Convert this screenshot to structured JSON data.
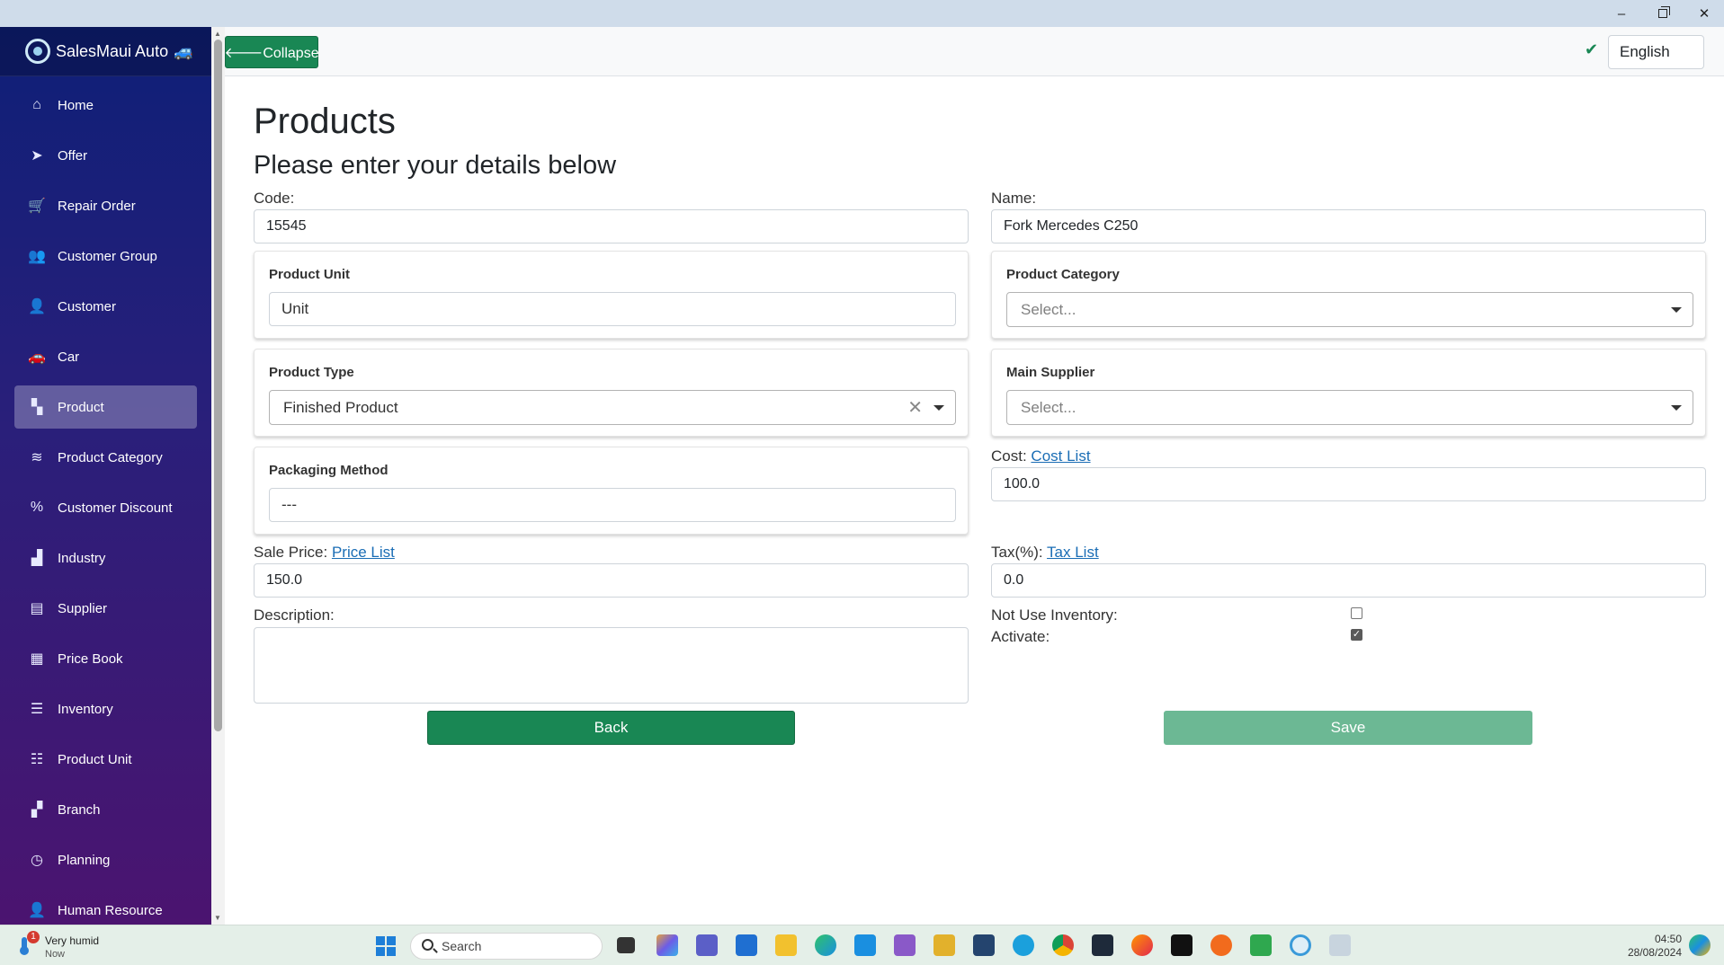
{
  "window": {
    "minimize_glyph": "–",
    "close_glyph": "✕"
  },
  "sidebar": {
    "brand": "SalesMaui Auto",
    "items": [
      {
        "label": "Home",
        "icon": "home-icon",
        "glyph": "⌂"
      },
      {
        "label": "Offer",
        "icon": "paper-plane-icon",
        "glyph": "➤"
      },
      {
        "label": "Repair Order",
        "icon": "cart-icon",
        "glyph": "🛒"
      },
      {
        "label": "Customer Group",
        "icon": "users-icon",
        "glyph": "👥"
      },
      {
        "label": "Customer",
        "icon": "user-icon",
        "glyph": "👤"
      },
      {
        "label": "Car",
        "icon": "car-icon",
        "glyph": "🚗"
      },
      {
        "label": "Product",
        "icon": "product-icon",
        "glyph": "▚",
        "active": true
      },
      {
        "label": "Product Category",
        "icon": "layers-icon",
        "glyph": "≋"
      },
      {
        "label": "Customer Discount",
        "icon": "percent-icon",
        "glyph": "%"
      },
      {
        "label": "Industry",
        "icon": "chart-icon",
        "glyph": "▟"
      },
      {
        "label": "Supplier",
        "icon": "warehouse-icon",
        "glyph": "▤"
      },
      {
        "label": "Price Book",
        "icon": "table-icon",
        "glyph": "▦"
      },
      {
        "label": "Inventory",
        "icon": "list-check-icon",
        "glyph": "☰"
      },
      {
        "label": "Product Unit",
        "icon": "list-icon",
        "glyph": "☷"
      },
      {
        "label": "Branch",
        "icon": "grid-icon",
        "glyph": "▞"
      },
      {
        "label": "Planning",
        "icon": "clock-icon",
        "glyph": "◷"
      },
      {
        "label": "Human Resource",
        "icon": "person-icon",
        "glyph": "👤"
      }
    ]
  },
  "topbar": {
    "collapse_label": "🡐Collapse",
    "language": "English",
    "status_glyph": "✔"
  },
  "page": {
    "title": "Products",
    "subtitle": "Please enter your details below"
  },
  "form": {
    "code_label": "Code:",
    "code_value": "15545",
    "name_label": "Name:",
    "name_value": "Fork Mercedes C250",
    "product_unit_label": "Product Unit",
    "product_unit_value": "Unit",
    "product_category_label": "Product Category",
    "product_category_placeholder": "Select...",
    "product_type_label": "Product Type",
    "product_type_value": "Finished Product",
    "main_supplier_label": "Main Supplier",
    "main_supplier_placeholder": "Select...",
    "packaging_method_label": "Packaging Method",
    "packaging_method_value": "---",
    "cost_label": "Cost:",
    "cost_link": "Cost List",
    "cost_value": "100.0",
    "sale_price_label": "Sale Price:",
    "price_link": "Price List",
    "sale_price_value": "150.0",
    "tax_label": "Tax(%):",
    "tax_link": "Tax List",
    "tax_value": "0.0",
    "description_label": "Description:",
    "not_use_inventory_label": "Not Use Inventory:",
    "not_use_inventory_checked": false,
    "activate_label": "Activate:",
    "activate_checked": true,
    "back_label": "Back",
    "save_label": "Save"
  },
  "taskbar": {
    "weather_title": "Very humid",
    "weather_sub": "Now",
    "weather_badge": "1",
    "search_label": "Search",
    "time": "04:50",
    "date": "28/08/2024"
  }
}
